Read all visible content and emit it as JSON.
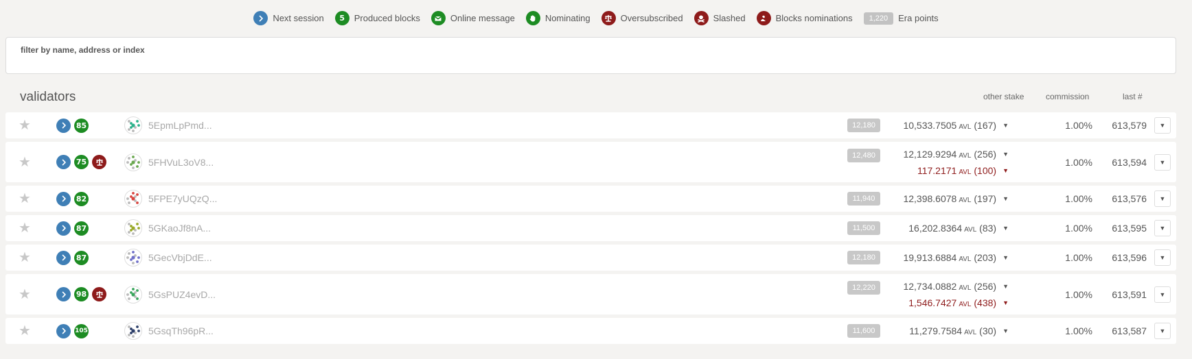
{
  "legend": [
    {
      "type": "icon",
      "icon": "chevron-right-icon",
      "color": "#3f7fb6",
      "label": "Next session"
    },
    {
      "type": "badge",
      "badge": "5",
      "color": "#1d8c23",
      "label": "Produced blocks"
    },
    {
      "type": "icon",
      "icon": "envelope-icon",
      "color": "#1d8c23",
      "label": "Online message"
    },
    {
      "type": "icon",
      "icon": "hand-icon",
      "color": "#1d8c23",
      "label": "Nominating"
    },
    {
      "type": "icon",
      "icon": "balance-scale-icon",
      "color": "#8e1b1b",
      "label": "Oversubscribed"
    },
    {
      "type": "icon",
      "icon": "skull-crossbones-icon",
      "color": "#8e1b1b",
      "label": "Slashed"
    },
    {
      "type": "icon",
      "icon": "user-slash-icon",
      "color": "#8e1b1b",
      "label": "Blocks nominations"
    },
    {
      "type": "pill",
      "badge": "1,220",
      "label": "Era points"
    }
  ],
  "filter": {
    "label": "filter by name, address or index",
    "value": ""
  },
  "table": {
    "title": "validators",
    "columns": {
      "other_stake": "other stake",
      "commission": "commission",
      "last": "last #"
    },
    "rows": [
      {
        "blocks": "85",
        "oversubscribed": false,
        "address": "5EpmLpPmd...",
        "identicon": "#2bb28b",
        "era_points": "12,180",
        "stakes": [
          {
            "amount": "10,533.7505",
            "unit": "AVL",
            "count": "(167)",
            "over": false
          }
        ],
        "commission": "1.00%",
        "last": "613,579"
      },
      {
        "blocks": "75",
        "oversubscribed": true,
        "address": "5FHVuL3oV8...",
        "identicon": "#6aa84f",
        "era_points": "12,480",
        "stakes": [
          {
            "amount": "12,129.9294",
            "unit": "AVL",
            "count": "(256)",
            "over": false
          },
          {
            "amount": "117.2171",
            "unit": "AVL",
            "count": "(100)",
            "over": true
          }
        ],
        "commission": "1.00%",
        "last": "613,594"
      },
      {
        "blocks": "82",
        "oversubscribed": false,
        "address": "5FPE7yUQzQ...",
        "identicon": "#d8453f",
        "era_points": "11,940",
        "stakes": [
          {
            "amount": "12,398.6078",
            "unit": "AVL",
            "count": "(197)",
            "over": false
          }
        ],
        "commission": "1.00%",
        "last": "613,576"
      },
      {
        "blocks": "87",
        "oversubscribed": false,
        "address": "5GKaoJf8nA...",
        "identicon": "#9aaa2a",
        "era_points": "11,500",
        "stakes": [
          {
            "amount": "16,202.8364",
            "unit": "AVL",
            "count": "(83)",
            "over": false
          }
        ],
        "commission": "1.00%",
        "last": "613,595"
      },
      {
        "blocks": "87",
        "oversubscribed": false,
        "address": "5GecVbjDdE...",
        "identicon": "#6f6fc9",
        "era_points": "12,180",
        "stakes": [
          {
            "amount": "19,913.6884",
            "unit": "AVL",
            "count": "(203)",
            "over": false
          }
        ],
        "commission": "1.00%",
        "last": "613,596"
      },
      {
        "blocks": "98",
        "oversubscribed": true,
        "address": "5GsPUZ4evD...",
        "identicon": "#3aa55c",
        "era_points": "12,220",
        "stakes": [
          {
            "amount": "12,734.0882",
            "unit": "AVL",
            "count": "(256)",
            "over": false
          },
          {
            "amount": "1,546.7427",
            "unit": "AVL",
            "count": "(438)",
            "over": true
          }
        ],
        "commission": "1.00%",
        "last": "613,591"
      },
      {
        "blocks": "105",
        "oversubscribed": false,
        "address": "5GsqTh96pR...",
        "identicon": "#2d3f6a",
        "era_points": "11,600",
        "stakes": [
          {
            "amount": "11,279.7584",
            "unit": "AVL",
            "count": "(30)",
            "over": false
          }
        ],
        "commission": "1.00%",
        "last": "613,587"
      }
    ]
  }
}
